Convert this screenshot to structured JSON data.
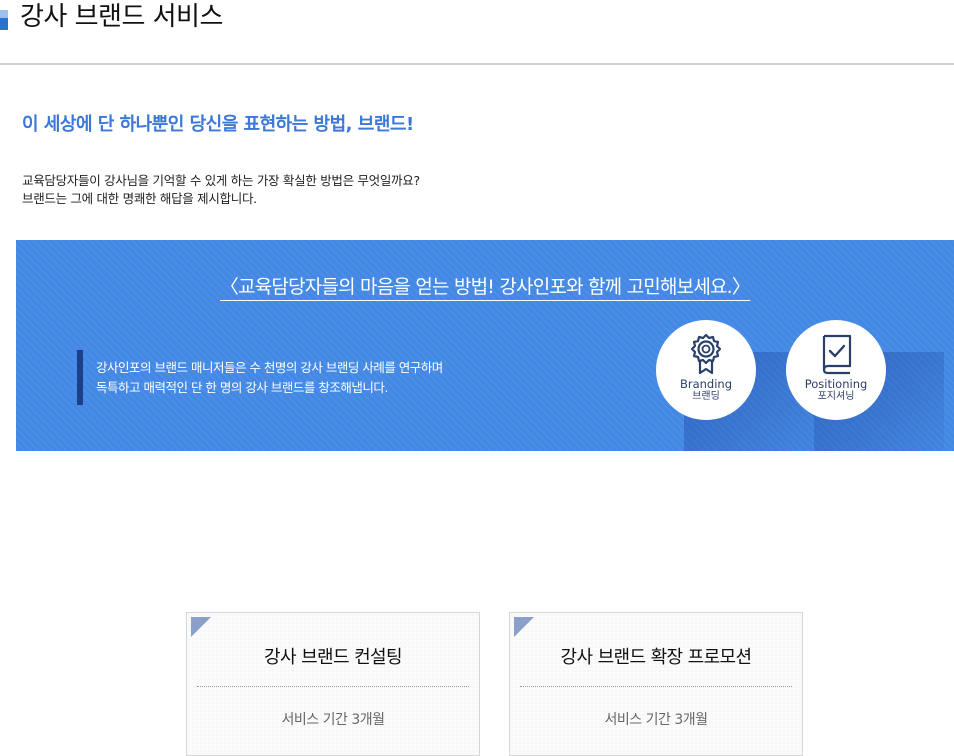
{
  "header": {
    "title": "강사 브랜드 서비스"
  },
  "intro": {
    "headline": "이 세상에 단 하나뿐인 당신을 표현하는 방법, 브랜드!",
    "line1": "교육담당자들이 강사님을 기억할 수 있게 하는 가장 확실한 방법은 무엇일까요?",
    "line2": "브랜드는 그에 대한 명쾌한 해답을 제시합니다."
  },
  "banner": {
    "heading": "〈교육담당자들의 마음을 얻는 방법! 강사인포와 함께 고민해보세요.〉",
    "line1": "강사인포의 브랜드 매니저들은 수 천명의 강사 브랜딩 사례를 연구하며",
    "line2": "독특하고 매력적인 단 한 명의 강사 브랜드를 창조해냅니다.",
    "badges": [
      {
        "label_en": "Branding",
        "label_ko": "브랜딩",
        "icon": "award-medal-icon"
      },
      {
        "label_en": "Positioning",
        "label_ko": "포지셔닝",
        "icon": "checklist-book-icon"
      }
    ],
    "colors": {
      "background": "#4288e4",
      "quote_bar": "#1d3f8a"
    }
  },
  "services": [
    {
      "title": "강사 브랜드 컨설팅",
      "period": "서비스 기간 3개월"
    },
    {
      "title": "강사 브랜드 확장 프로모션",
      "period": "서비스 기간 3개월"
    }
  ],
  "colors": {
    "accent": "#3c78d8",
    "title_marker": "#2f6fd0"
  }
}
